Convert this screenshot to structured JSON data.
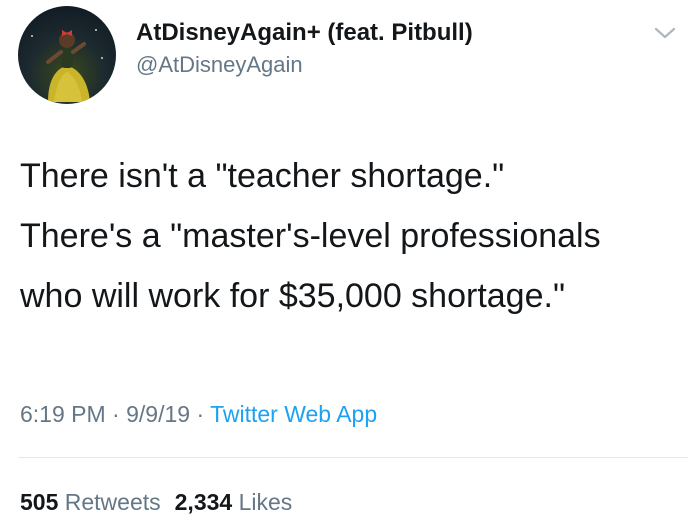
{
  "author": {
    "display_name": "AtDisneyAgain+ (feat. Pitbull)",
    "handle": "@AtDisneyAgain",
    "avatar_icon": "person-in-yellow-gown-avatar"
  },
  "tweet": {
    "text": "There isn't a \"teacher shortage.\"\nThere's a \"master's-level professionals\nwho will work for $35,000 shortage.\""
  },
  "meta": {
    "time": "6:19 PM",
    "sep1": " · ",
    "date": "9/9/19",
    "sep2": " · ",
    "source": "Twitter Web App"
  },
  "stats": {
    "retweets_count": "505",
    "retweets_label": "Retweets",
    "likes_count": "2,334",
    "likes_label": "Likes"
  },
  "colors": {
    "text": "#14171a",
    "secondary": "#657786",
    "link": "#1da1f2",
    "divider": "#e1e8ed"
  },
  "icons": {
    "menu_caret": "chevron-down-icon"
  }
}
